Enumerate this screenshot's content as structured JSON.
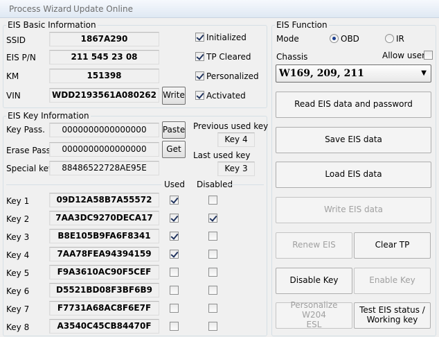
{
  "menu": {
    "process_wizard": "Process Wizard",
    "update_online": "Update Online"
  },
  "basic": {
    "title": "EIS Basic Information",
    "ssid_label": "SSID",
    "ssid": "1867A290",
    "pn_label": "EIS P/N",
    "pn": "211 545 23 08",
    "km_label": "KM",
    "km": "151398",
    "vin_label": "VIN",
    "vin": "WDD2193561A080262",
    "write": "Write",
    "initialized": "Initialized",
    "tp_cleared": "TP Cleared",
    "personalized": "Personalized",
    "activated": "Activated"
  },
  "keyinfo": {
    "title": "EIS Key Information",
    "key_pass_label": "Key Pass.",
    "key_pass": "0000000000000000",
    "erase_pass_label": "Erase Pass.",
    "erase_pass": "0000000000000000",
    "special_key_label": "Special key",
    "special_key": "88486522728AE95E",
    "paste": "Paste",
    "get": "Get",
    "prev_used_label": "Previous used key",
    "prev_used": "Key 4",
    "last_used_label": "Last used key",
    "last_used": "Key 3"
  },
  "keys": {
    "used_label": "Used",
    "disabled_label": "Disabled",
    "rows": [
      {
        "label": "Key 1",
        "value": "09D12A58B7A55572",
        "used": true,
        "disabled": false
      },
      {
        "label": "Key 2",
        "value": "7AA3DC9270DECA17",
        "used": true,
        "disabled": true
      },
      {
        "label": "Key 3",
        "value": "B8E105B9FA6F8341",
        "used": true,
        "disabled": false
      },
      {
        "label": "Key 4",
        "value": "7AA78FEA94394159",
        "used": true,
        "disabled": false
      },
      {
        "label": "Key 5",
        "value": "F9A3610AC90F5CEF",
        "used": false,
        "disabled": false
      },
      {
        "label": "Key 6",
        "value": "D5521BD08F3BF6B9",
        "used": false,
        "disabled": false
      },
      {
        "label": "Key 7",
        "value": "F7731A68AC8F6E7F",
        "used": false,
        "disabled": false
      },
      {
        "label": "Key 8",
        "value": "A3540C45CB84470F",
        "used": false,
        "disabled": false
      }
    ]
  },
  "function": {
    "title": "EIS Function",
    "mode_label": "Mode",
    "obd": "OBD",
    "ir": "IR",
    "chassis_label": "Chassis",
    "allow_user": "Allow user",
    "chassis": "W169, 209, 211",
    "read": "Read EIS data and password",
    "save": "Save EIS data",
    "load": "Load EIS data",
    "write_eis": "Write EIS data",
    "renew": "Renew EIS",
    "clear_tp": "Clear TP",
    "disable_key": "Disable Key",
    "enable_key": "Enable Key",
    "personalize_1": "Personalize W204",
    "personalize_2": "ESL",
    "test_1": "Test EIS status /",
    "test_2": "Working key"
  }
}
